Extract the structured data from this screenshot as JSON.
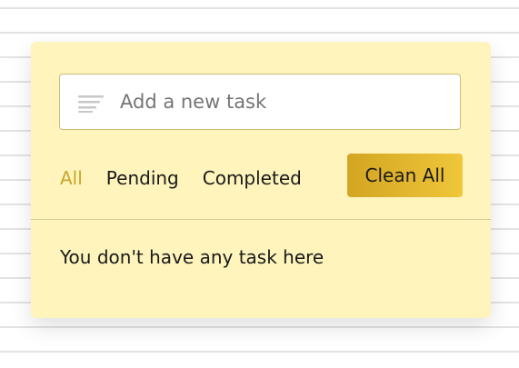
{
  "task_input": {
    "placeholder": "Add a new task",
    "value": ""
  },
  "filters": [
    {
      "label": "All",
      "active": true
    },
    {
      "label": "Pending",
      "active": false
    },
    {
      "label": "Completed",
      "active": false
    }
  ],
  "clear_button": {
    "label": "Clean All"
  },
  "task_list": {
    "empty_message": "You don't have any task here"
  },
  "colors": {
    "card_bg": "#fef4bc",
    "accent": "#c9a52a",
    "button_gradient_start": "#d3a522",
    "button_gradient_end": "#f0c63a"
  },
  "icons": {
    "input_icon": "list-lines-icon"
  }
}
